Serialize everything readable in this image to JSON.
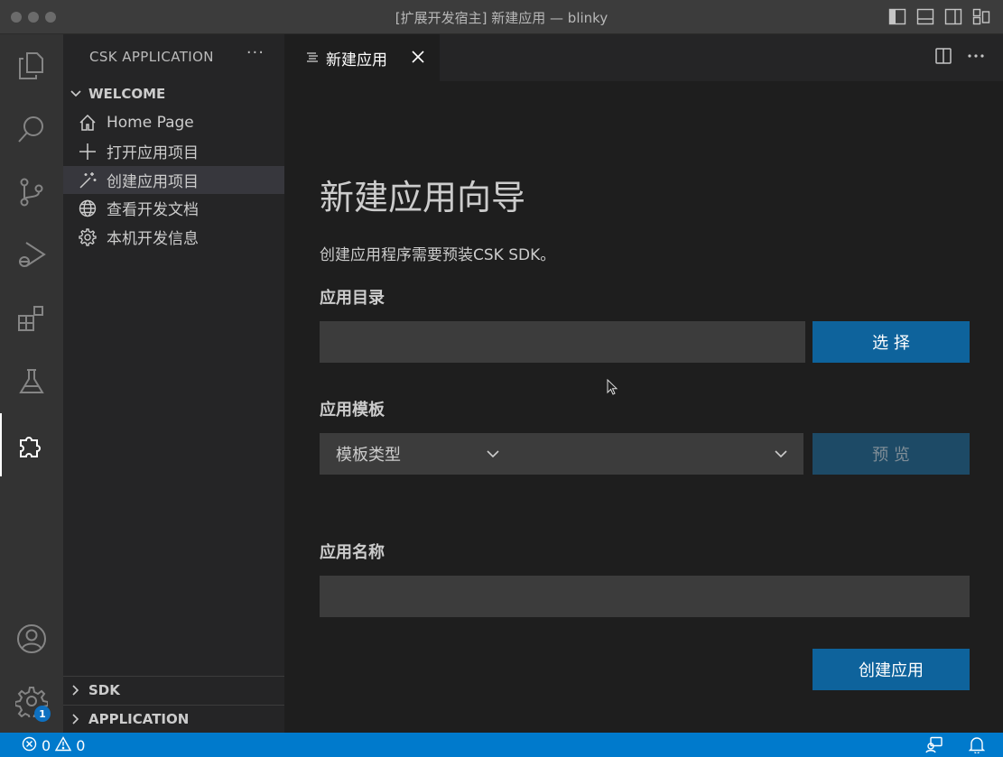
{
  "window": {
    "title": "[扩展开发宿主] 新建应用 — blinky"
  },
  "activity_bar": {
    "items": [
      "explorer-icon",
      "search-icon",
      "source-control-icon",
      "run-debug-icon",
      "extensions-icon",
      "testing-icon",
      "csk-extension-icon"
    ],
    "bottom_items": [
      "account-icon",
      "manage-gear-icon"
    ],
    "settings_badge": "1"
  },
  "sidebar": {
    "title": "CSK APPLICATION",
    "more": "···",
    "welcome_section": "WELCOME",
    "items": [
      {
        "label": "Home Page",
        "icon": "home-icon"
      },
      {
        "label": "打开应用项目",
        "icon": "plus-icon"
      },
      {
        "label": "创建应用项目",
        "icon": "wand-icon"
      },
      {
        "label": "查看开发文档",
        "icon": "globe-icon"
      },
      {
        "label": "本机开发信息",
        "icon": "gear-icon"
      }
    ],
    "selected_index": 2,
    "sdk_section": "SDK",
    "application_section": "APPLICATION"
  },
  "tab": {
    "label": "新建应用"
  },
  "wizard": {
    "title": "新建应用向导",
    "description": "创建应用程序需要预装CSK SDK。",
    "dir_label": "应用目录",
    "dir_value": "",
    "choose_button": "选 择",
    "template_label": "应用模板",
    "template_value": "模板类型",
    "preview_button": "预 览",
    "name_label": "应用名称",
    "name_value": "",
    "create_button": "创建应用"
  },
  "status_bar": {
    "errors": "0",
    "warnings": "0"
  },
  "colors": {
    "accent": "#007acc",
    "button": "#0e639c",
    "button_disabled": "#1d4a66"
  }
}
